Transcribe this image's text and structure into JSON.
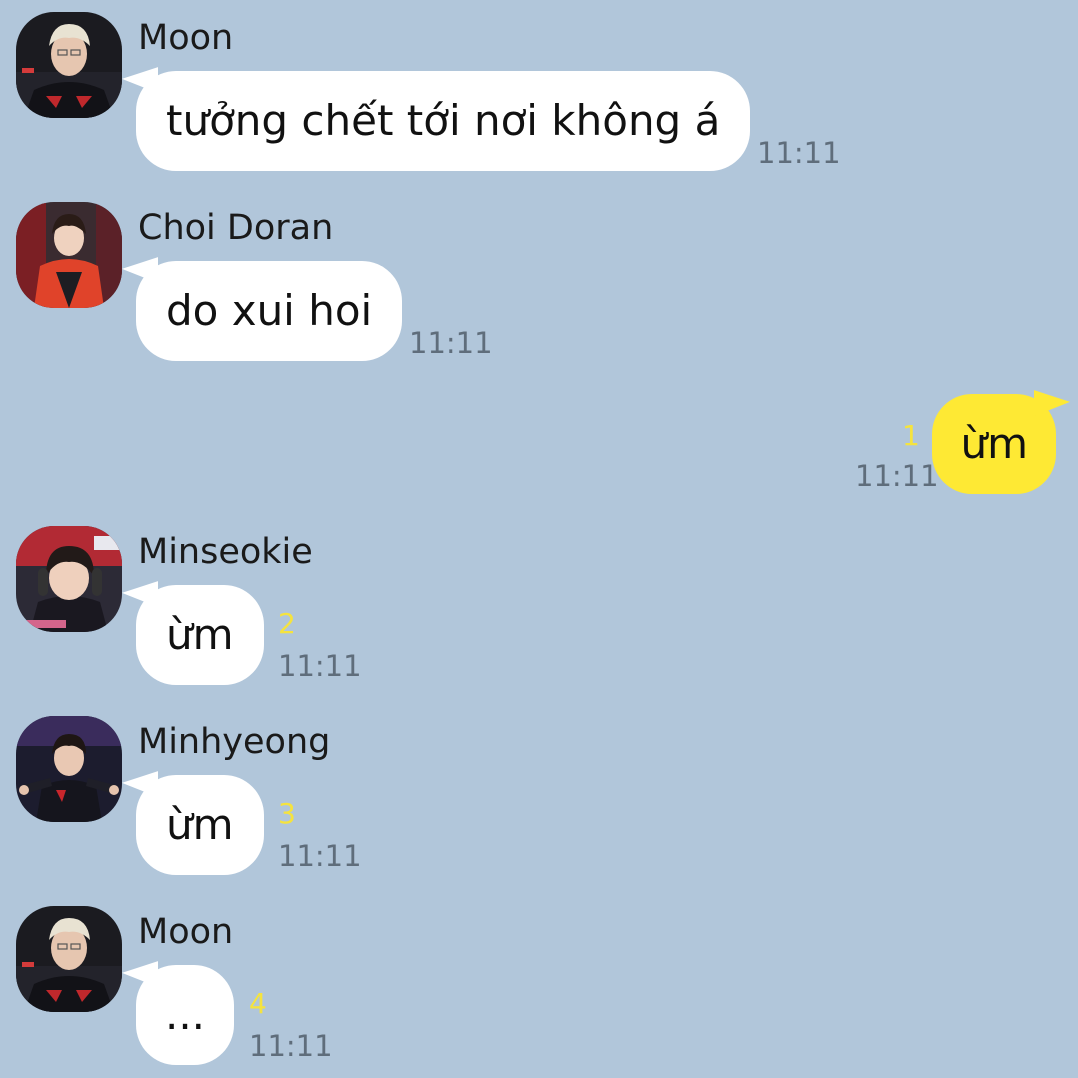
{
  "messages": [
    {
      "sender": "Moon",
      "text": "tưởng chết tới nơi không á",
      "time": "11:11"
    },
    {
      "sender": "Choi Doran",
      "text": "do xui hoi",
      "time": "11:11"
    },
    {
      "sender": "me",
      "text": "ừm",
      "time": "11:11",
      "unread": "1"
    },
    {
      "sender": "Minseokie",
      "text": "ừm",
      "time": "11:11",
      "unread": "2"
    },
    {
      "sender": "Minhyeong",
      "text": "ừm",
      "time": "11:11",
      "unread": "3"
    },
    {
      "sender": "Moon",
      "text": "...",
      "time": "11:11",
      "unread": "4"
    }
  ],
  "colors": {
    "background": "#b1c6da",
    "incoming_bubble": "#ffffff",
    "outgoing_bubble": "#fee934",
    "unread_count": "#f5e33e",
    "timestamp": "#5f6d7b"
  }
}
